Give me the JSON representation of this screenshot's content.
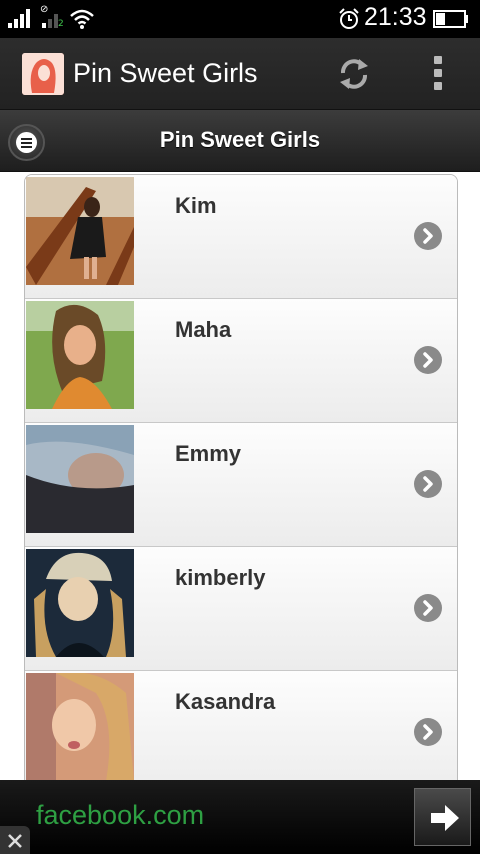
{
  "status_bar": {
    "time": "21:33",
    "sim2_label": "2",
    "icons": [
      "signal-icon",
      "signal-2-icon",
      "wifi-icon",
      "alarm-icon",
      "battery-icon"
    ]
  },
  "action_bar": {
    "title": "Pin Sweet Girls",
    "icons": [
      "app-logo-icon",
      "refresh-icon",
      "overflow-menu-icon"
    ]
  },
  "header": {
    "title": "Pin Sweet Girls",
    "icons": [
      "menu-icon"
    ]
  },
  "list": {
    "items": [
      {
        "name": "Kim",
        "icon": "chevron-right-icon",
        "photo_tone": "#b07040"
      },
      {
        "name": "Maha",
        "icon": "chevron-right-icon",
        "photo_tone": "#7fa84e"
      },
      {
        "name": "Emmy",
        "icon": "chevron-right-icon",
        "photo_tone": "#8aa2b6"
      },
      {
        "name": "kimberly",
        "icon": "chevron-right-icon",
        "photo_tone": "#1c2a3a"
      },
      {
        "name": "Kasandra",
        "icon": "chevron-right-icon",
        "photo_tone": "#d49a78"
      }
    ]
  },
  "ad": {
    "text": "facebook.com",
    "text_color": "#2ea043",
    "icons": [
      "arrow-right-icon",
      "close-icon"
    ]
  }
}
